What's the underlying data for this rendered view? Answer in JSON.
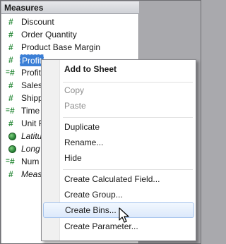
{
  "panel": {
    "title": "Measures",
    "fields": [
      {
        "label": "Discount",
        "icon": "measure-hash-icon"
      },
      {
        "label": "Order Quantity",
        "icon": "measure-hash-icon"
      },
      {
        "label": "Product Base Margin",
        "icon": "measure-hash-icon"
      },
      {
        "label": "Profit",
        "icon": "measure-hash-icon",
        "selected": true
      },
      {
        "label": "Profit",
        "icon": "calculated-measure-icon"
      },
      {
        "label": "Sales",
        "icon": "measure-hash-icon"
      },
      {
        "label": "Shipp",
        "icon": "measure-hash-icon"
      },
      {
        "label": "Time",
        "icon": "calculated-measure-icon"
      },
      {
        "label": "Unit P",
        "icon": "measure-hash-icon"
      },
      {
        "label": "Latitu",
        "icon": "globe-icon",
        "italic": true
      },
      {
        "label": "Long",
        "icon": "globe-icon",
        "italic": true
      },
      {
        "label": "Num",
        "icon": "calculated-measure-icon"
      },
      {
        "label": "Meas",
        "icon": "measure-hash-icon",
        "italic": true
      }
    ]
  },
  "context_menu": {
    "items": [
      {
        "label": "Add to Sheet",
        "bold": true
      },
      {
        "label": "Copy",
        "disabled": true
      },
      {
        "label": "Paste",
        "disabled": true
      },
      {
        "label": "Duplicate"
      },
      {
        "label": "Rename..."
      },
      {
        "label": "Hide"
      },
      {
        "label": "Create Calculated Field..."
      },
      {
        "label": "Create Group..."
      },
      {
        "label": "Create Bins...",
        "hover": true
      },
      {
        "label": "Create Parameter..."
      }
    ]
  },
  "colors": {
    "selection": "#3b7fd6",
    "measure_icon": "#2a8a3a",
    "menu_hover": "#dce9fb"
  }
}
